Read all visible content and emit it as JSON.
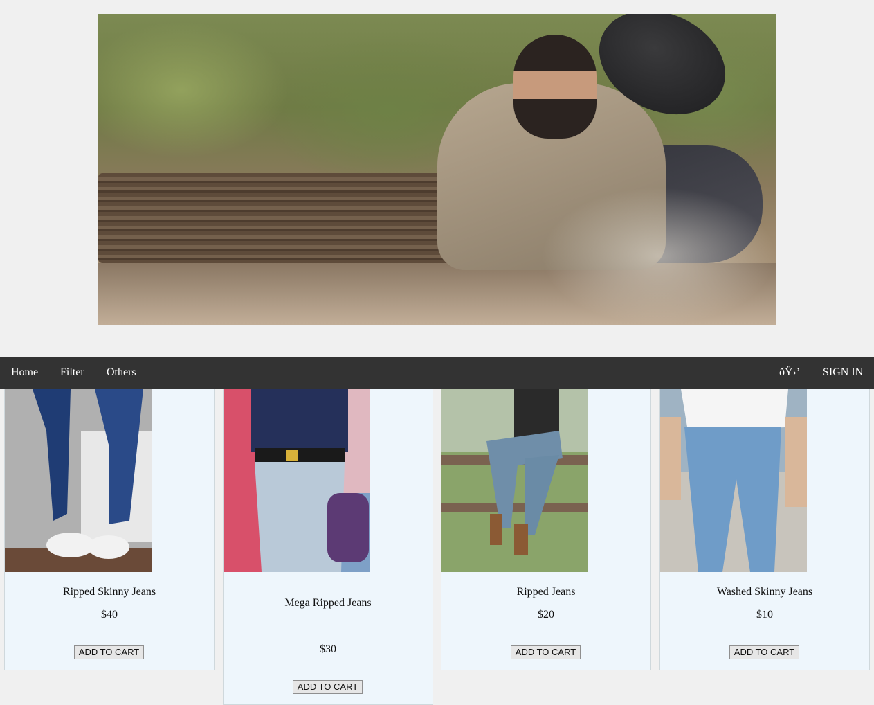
{
  "hero": {
    "alt": "Bearded man in knit cardigan sitting by a log holding a hat"
  },
  "navbar": {
    "links": [
      "Home",
      "Filter",
      "Others"
    ],
    "icon_glyph": "ðŸ›’",
    "sign_in": "SIGN IN"
  },
  "products": [
    {
      "name": "Ripped Skinny Jeans",
      "price": "$40",
      "button": "ADD TO CART"
    },
    {
      "name": "Mega Ripped Jeans",
      "price": "$30",
      "button": "ADD TO CART"
    },
    {
      "name": "Ripped Jeans",
      "price": "$20",
      "button": "ADD TO CART"
    },
    {
      "name": "Washed Skinny Jeans",
      "price": "$10",
      "button": "ADD TO CART"
    }
  ],
  "colors": {
    "navbar": "#333333",
    "card_bg": "#eef6fc",
    "page_bg": "#f0f0f0"
  }
}
